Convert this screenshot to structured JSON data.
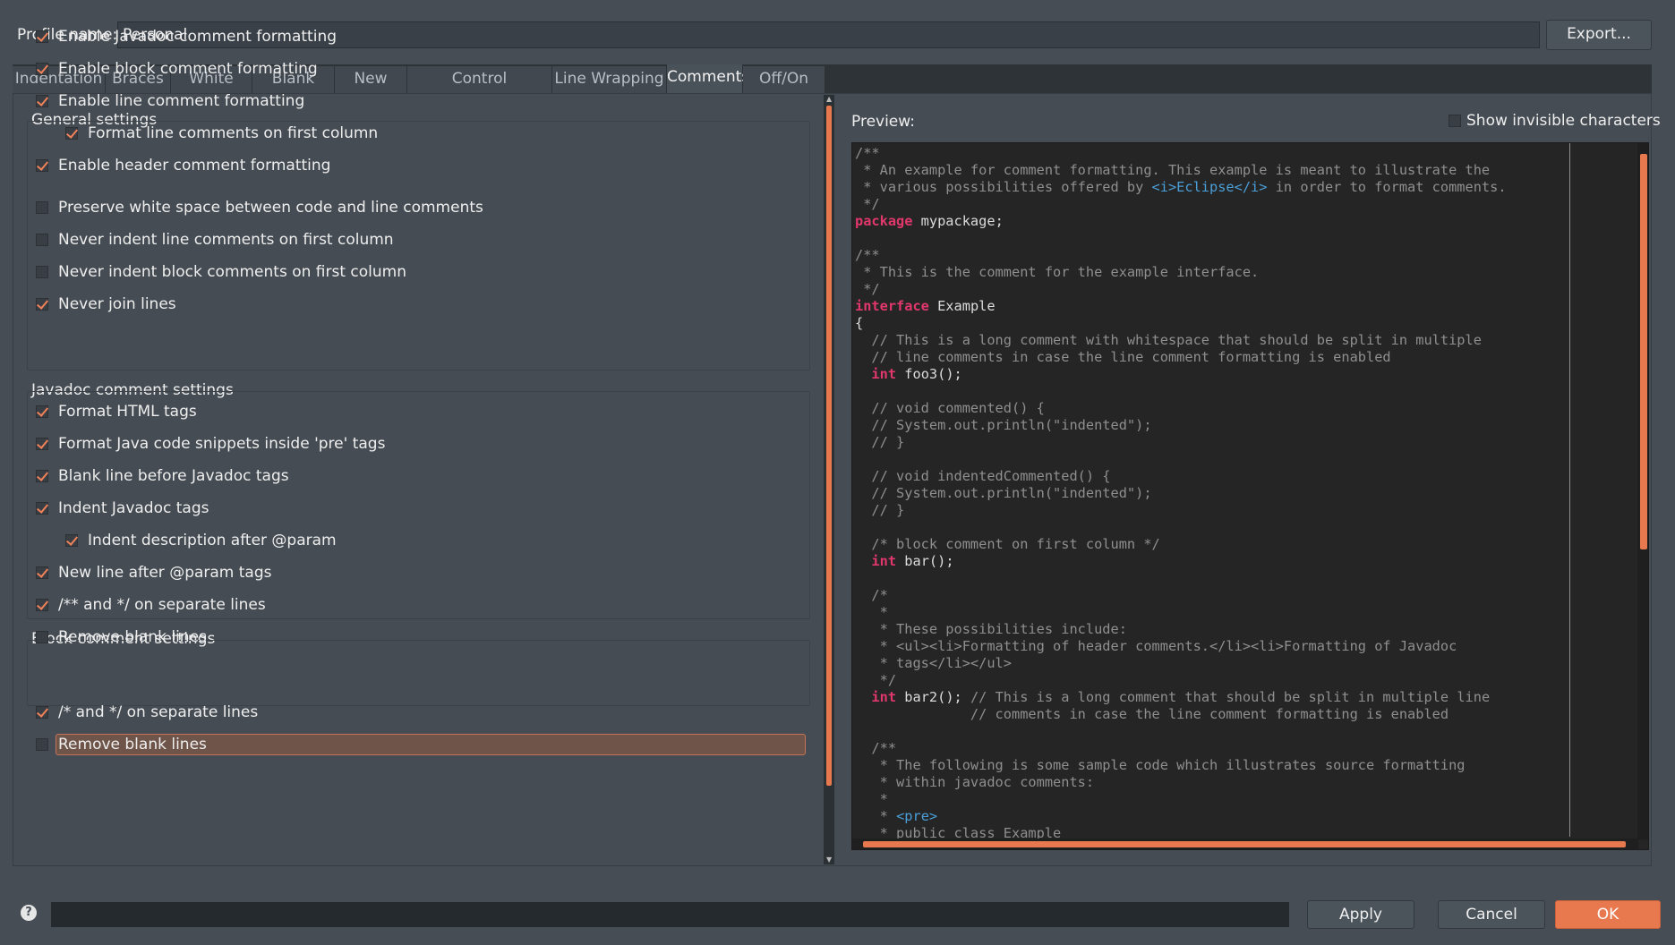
{
  "profile": {
    "label": "Profile name:",
    "value": "Personal",
    "export_label": "Export..."
  },
  "tabs": [
    "Indentation",
    "Braces",
    "White Space",
    "Blank Lines",
    "New Lines",
    "Control Statements",
    "Line Wrapping",
    "Comments",
    "Off/On Tags"
  ],
  "active_tab": "Comments",
  "general": {
    "title": "General settings",
    "items": [
      {
        "label": "Enable Javadoc comment formatting",
        "checked": true
      },
      {
        "label": "Enable block comment formatting",
        "checked": true
      },
      {
        "label": "Enable line comment formatting",
        "checked": true
      },
      {
        "label": "Format line comments on first column",
        "checked": true
      },
      {
        "label": "Enable header comment formatting",
        "checked": true
      },
      {
        "label": "Preserve white space between code and line comments",
        "checked": false
      },
      {
        "label": "Never indent line comments on first column",
        "checked": false
      },
      {
        "label": "Never indent block comments on first column",
        "checked": false
      },
      {
        "label": "Never join lines",
        "checked": true
      }
    ]
  },
  "javadoc": {
    "title": "Javadoc comment settings",
    "items": [
      {
        "label": "Format HTML tags",
        "checked": true
      },
      {
        "label": "Format Java code snippets inside 'pre' tags",
        "checked": true
      },
      {
        "label": "Blank line before Javadoc tags",
        "checked": true
      },
      {
        "label": "Indent Javadoc tags",
        "checked": true
      },
      {
        "label": "Indent description after @param",
        "checked": true
      },
      {
        "label": "New line after @param tags",
        "checked": true
      },
      {
        "label": "/** and */ on separate lines",
        "checked": true
      },
      {
        "label": "Remove blank lines",
        "checked": false
      }
    ]
  },
  "block": {
    "title": "Block comment settings",
    "items": [
      {
        "label": "/* and */ on separate lines",
        "checked": true
      },
      {
        "label": "Remove blank lines",
        "checked": false
      }
    ]
  },
  "preview": {
    "label": "Preview:",
    "show_invisible_label": "Show invisible characters",
    "show_invisible_checked": false,
    "lines": [
      [
        [
          "c",
          "/**"
        ]
      ],
      [
        [
          "c",
          " * An example for comment formatting. This example is meant to illustrate the"
        ]
      ],
      [
        [
          "c",
          " * various possibilities offered by "
        ],
        [
          "t",
          "<i>Eclipse</i>"
        ],
        [
          "c",
          " in order to format comments."
        ]
      ],
      [
        [
          "c",
          " */"
        ]
      ],
      [
        [
          "k",
          "package"
        ],
        [
          "n",
          " mypackage;"
        ]
      ],
      [
        [
          "n",
          ""
        ]
      ],
      [
        [
          "c",
          "/**"
        ]
      ],
      [
        [
          "c",
          " * This is the comment for the example interface."
        ]
      ],
      [
        [
          "c",
          " */"
        ]
      ],
      [
        [
          "k",
          "interface"
        ],
        [
          "n",
          " Example"
        ]
      ],
      [
        [
          "n",
          "{"
        ]
      ],
      [
        [
          "c",
          "  // This is a long comment with whitespace that should be split in multiple"
        ]
      ],
      [
        [
          "c",
          "  // line comments in case the line comment formatting is enabled"
        ]
      ],
      [
        [
          "n",
          "  "
        ],
        [
          "k",
          "int"
        ],
        [
          "n",
          " foo3();"
        ]
      ],
      [
        [
          "n",
          ""
        ]
      ],
      [
        [
          "c",
          "  // void commented() {"
        ]
      ],
      [
        [
          "c",
          "  // System.out.println(\"indented\");"
        ]
      ],
      [
        [
          "c",
          "  // }"
        ]
      ],
      [
        [
          "n",
          ""
        ]
      ],
      [
        [
          "c",
          "  // void indentedCommented() {"
        ]
      ],
      [
        [
          "c",
          "  // System.out.println(\"indented\");"
        ]
      ],
      [
        [
          "c",
          "  // }"
        ]
      ],
      [
        [
          "n",
          ""
        ]
      ],
      [
        [
          "c",
          "  /* block comment on first column */"
        ]
      ],
      [
        [
          "n",
          "  "
        ],
        [
          "k",
          "int"
        ],
        [
          "n",
          " bar();"
        ]
      ],
      [
        [
          "n",
          ""
        ]
      ],
      [
        [
          "c",
          "  /*"
        ]
      ],
      [
        [
          "c",
          "   *"
        ]
      ],
      [
        [
          "c",
          "   * These possibilities include:"
        ]
      ],
      [
        [
          "c",
          "   * <ul><li>Formatting of header comments.</li><li>Formatting of Javadoc"
        ]
      ],
      [
        [
          "c",
          "   * tags</li></ul>"
        ]
      ],
      [
        [
          "c",
          "   */"
        ]
      ],
      [
        [
          "n",
          "  "
        ],
        [
          "k",
          "int"
        ],
        [
          "n",
          " bar2(); "
        ],
        [
          "c",
          "// This is a long comment that should be split in multiple line"
        ]
      ],
      [
        [
          "c",
          "              // comments in case the line comment formatting is enabled"
        ]
      ],
      [
        [
          "n",
          ""
        ]
      ],
      [
        [
          "c",
          "  /**"
        ]
      ],
      [
        [
          "c",
          "   * The following is some sample code which illustrates source formatting"
        ]
      ],
      [
        [
          "c",
          "   * within javadoc comments:"
        ]
      ],
      [
        [
          "c",
          "   *"
        ]
      ],
      [
        [
          "c",
          "   * "
        ],
        [
          "t",
          "<pre>"
        ]
      ],
      [
        [
          "c",
          "   * public class Example"
        ]
      ]
    ]
  },
  "buttons": {
    "apply": "Apply",
    "cancel": "Cancel",
    "ok": "OK"
  },
  "colors": {
    "accent": "#e8784d",
    "keyword": "#e0376c",
    "tag": "#4a9fd9",
    "comment": "#8f8f8f"
  }
}
